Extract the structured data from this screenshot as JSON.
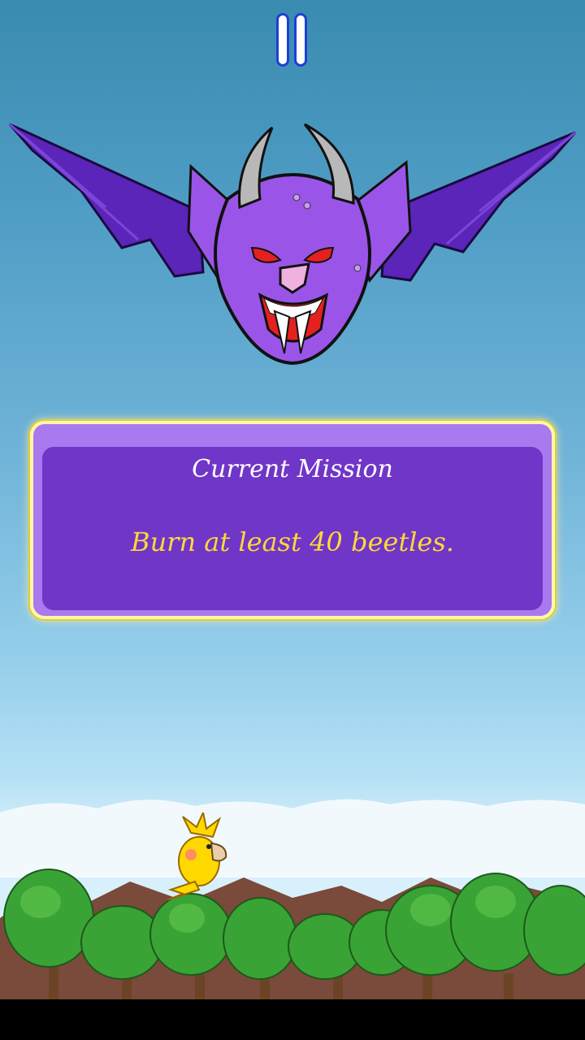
{
  "mission": {
    "title": "Current Mission",
    "text": "Burn at least 40 beetles."
  },
  "icons": {
    "pause": "pause-icon",
    "boss": "demon-bat-boss",
    "player": "yellow-bird"
  },
  "colors": {
    "sky_top": "#3a8bb0",
    "sky_bottom": "#d8f0fb",
    "panel_outer": "#a979f0",
    "panel_inner": "#7036c8",
    "panel_border": "#fff9a8",
    "mission_title_color": "#ffffff",
    "mission_text_color": "#ffd83a",
    "bat_body": "#9a55e8",
    "bat_wing": "#5a25b8",
    "tree_green": "#3aa336"
  }
}
